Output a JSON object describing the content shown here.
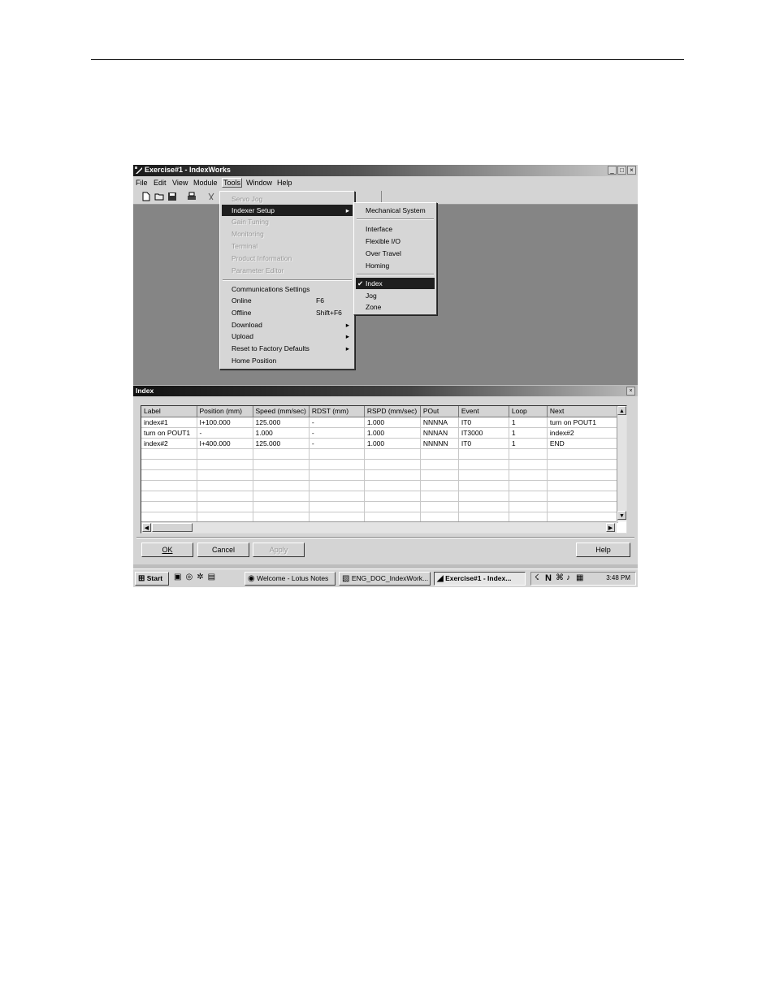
{
  "window": {
    "title": "Exercise#1 - IndexWorks",
    "controls": [
      "_",
      "□",
      "×"
    ]
  },
  "menubar": [
    "File",
    "Edit",
    "View",
    "Module",
    "Tools",
    "Window",
    "Help"
  ],
  "tools_menu": {
    "items": [
      {
        "label": "Servo Jog",
        "disabled": true
      },
      {
        "label": "Indexer Setup",
        "arrow": "▸",
        "selected": true
      },
      {
        "label": "Gain Tuning",
        "disabled": true
      },
      {
        "label": "Monitoring",
        "disabled": true
      },
      {
        "label": "Terminal",
        "disabled": true
      },
      {
        "label": "Product Information",
        "disabled": true
      },
      {
        "label": "Parameter Editor",
        "disabled": true
      },
      {
        "label": "Communications Settings"
      },
      {
        "label": "Online",
        "shortcut": "F6"
      },
      {
        "label": "Offline",
        "shortcut": "Shift+F6"
      },
      {
        "label": "Download",
        "arrow": "▸"
      },
      {
        "label": "Upload",
        "arrow": "▸"
      },
      {
        "label": "Reset to Factory Defaults",
        "arrow": "▸"
      },
      {
        "label": "Home Position"
      }
    ]
  },
  "indexer_submenu": {
    "items": [
      {
        "label": "Mechanical System"
      },
      {
        "label": "Interface"
      },
      {
        "label": "Flexible I/O"
      },
      {
        "label": "Over Travel"
      },
      {
        "label": "Homing"
      },
      {
        "label": "Index",
        "checked": "✔",
        "selected": true
      },
      {
        "label": "Jog"
      },
      {
        "label": "Zone"
      }
    ]
  },
  "dialog": {
    "title": "Index",
    "close": "×",
    "columns": [
      "Label",
      "Position (mm)",
      "Speed (mm/sec)",
      "RDST (mm)",
      "RSPD (mm/sec)",
      "POut",
      "Event",
      "Loop",
      "Next"
    ],
    "rows": [
      [
        "index#1",
        "I+100.000",
        "125.000",
        "-",
        "1.000",
        "NNNNA",
        "IT0",
        "1",
        "turn on POUT1"
      ],
      [
        "turn on POUT1",
        "-",
        "1.000",
        "-",
        "1.000",
        "NNNAN",
        "IT3000",
        "1",
        "index#2"
      ],
      [
        "index#2",
        "I+400.000",
        "125.000",
        "-",
        "1.000",
        "NNNNN",
        "IT0",
        "1",
        "END"
      ]
    ],
    "buttons": {
      "ok": "OK",
      "cancel": "Cancel",
      "apply": "Apply",
      "help": "Help"
    }
  },
  "taskbar": {
    "start": "Start",
    "tasks": [
      "Welcome - Lotus Notes",
      "ENG_DOC_IndexWork...",
      "Exercise#1 - Index..."
    ],
    "tray_letters": "N",
    "clock": "3:48 PM"
  },
  "colors": {
    "menu_highlight": "#1e1e1e",
    "desktop": "#858585",
    "chrome": "#d4d4d4"
  }
}
